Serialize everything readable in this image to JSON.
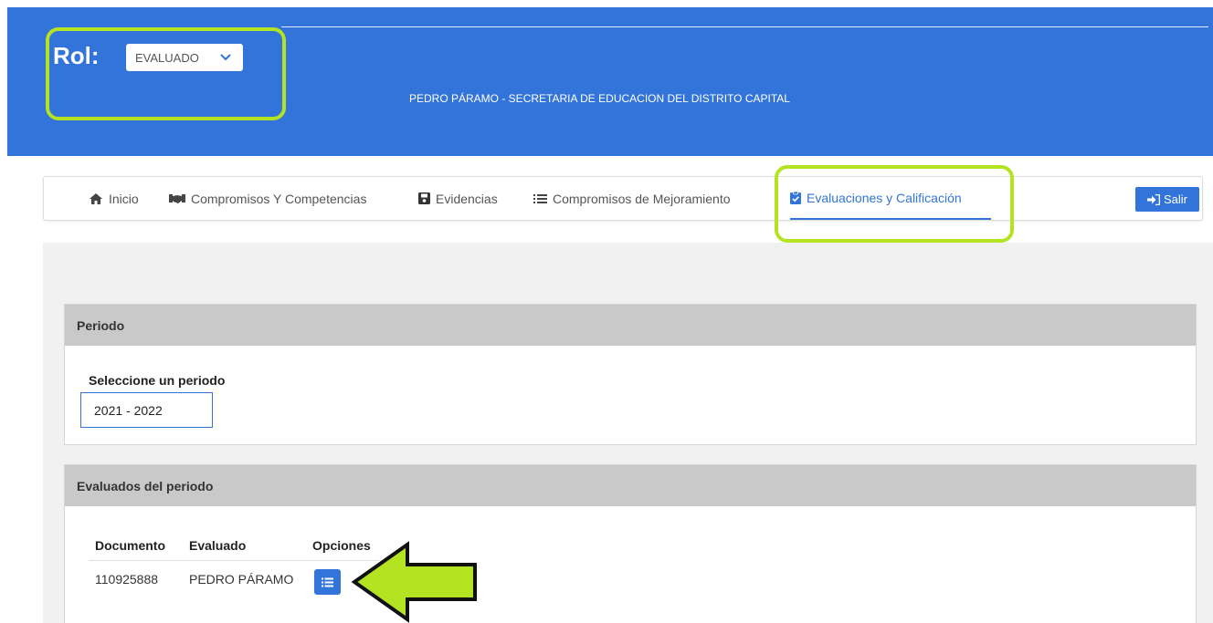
{
  "header": {
    "role_label": "Rol:",
    "role_select_value": "EVALUADO",
    "user_info": "PEDRO PÁRAMO - SECRETARIA DE EDUCACION DEL DISTRITO CAPITAL",
    "bg_color": "#3274d9"
  },
  "nav": {
    "items": [
      {
        "label": "Inicio",
        "icon": "home-icon"
      },
      {
        "label": "Compromisos Y Competencias",
        "icon": "handshake-icon"
      },
      {
        "label": "Evidencias",
        "icon": "save-icon"
      },
      {
        "label": "Compromisos de Mejoramiento",
        "icon": "list-icon"
      },
      {
        "label": "Evaluaciones y Calificación",
        "icon": "clipboard-check-icon",
        "active": true
      }
    ],
    "logout_label": "Salir",
    "logout_icon": "sign-in-icon"
  },
  "period_card": {
    "title": "Periodo",
    "select_label": "Seleccione un periodo",
    "select_value": "2021 - 2022"
  },
  "evaluated_card": {
    "title": "Evaluados del periodo",
    "columns": [
      "Documento",
      "Evaluado",
      "Opciones"
    ],
    "rows": [
      {
        "documento": "110925888",
        "evaluado": "PEDRO PÁRAMO",
        "option_icon": "list-icon"
      }
    ]
  },
  "annotations": {
    "highlight_color": "#b3e321",
    "arrow_color": "#b3e321"
  }
}
